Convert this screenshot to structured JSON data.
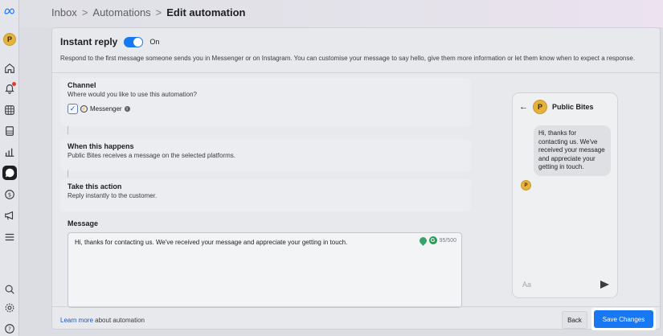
{
  "breadcrumb": {
    "inbox": "Inbox",
    "automations": "Automations",
    "current": "Edit automation",
    "separator": ">"
  },
  "rail": {
    "avatar_letter": "P",
    "icons": [
      "meta-logo-icon",
      "home-icon",
      "notifications-icon",
      "grid-icon",
      "pages-icon",
      "insights-icon",
      "inbox-icon",
      "monetization-icon",
      "ads-icon",
      "menu-icon",
      "search-icon",
      "settings-icon",
      "help-icon"
    ]
  },
  "instant_reply": {
    "title": "Instant reply",
    "toggle_label": "On",
    "toggle_on": true,
    "description": "Respond to the first message someone sends you in Messenger or on Instagram. You can customise your message to say hello, give them more information or let them know when to expect a response."
  },
  "channel": {
    "heading": "Channel",
    "subtext": "Where would you like to use this automation?",
    "option_label": "Messenger",
    "checked": true
  },
  "trigger": {
    "heading": "When this happens",
    "subtext": "Public Bites receives a message on the selected platforms."
  },
  "action": {
    "heading": "Take this action",
    "subtext": "Reply instantly to the customer."
  },
  "message": {
    "label": "Message",
    "text": "Hi, thanks for contacting us. We've received your message and appreciate your getting in touch.",
    "counter": "95/500"
  },
  "preview": {
    "page_name": "Public Bites",
    "avatar_letter": "P",
    "bubble_text": "Hi, thanks for contacting us. We've received your message and appreciate your getting in touch.",
    "input_placeholder": "Aa"
  },
  "footer": {
    "learn_link": "Learn more",
    "learn_suffix": " about automation",
    "back_label": "Back",
    "save_label": "Save Changes"
  },
  "colors": {
    "accent": "#1877f2",
    "avatar": "#e5b23f"
  }
}
